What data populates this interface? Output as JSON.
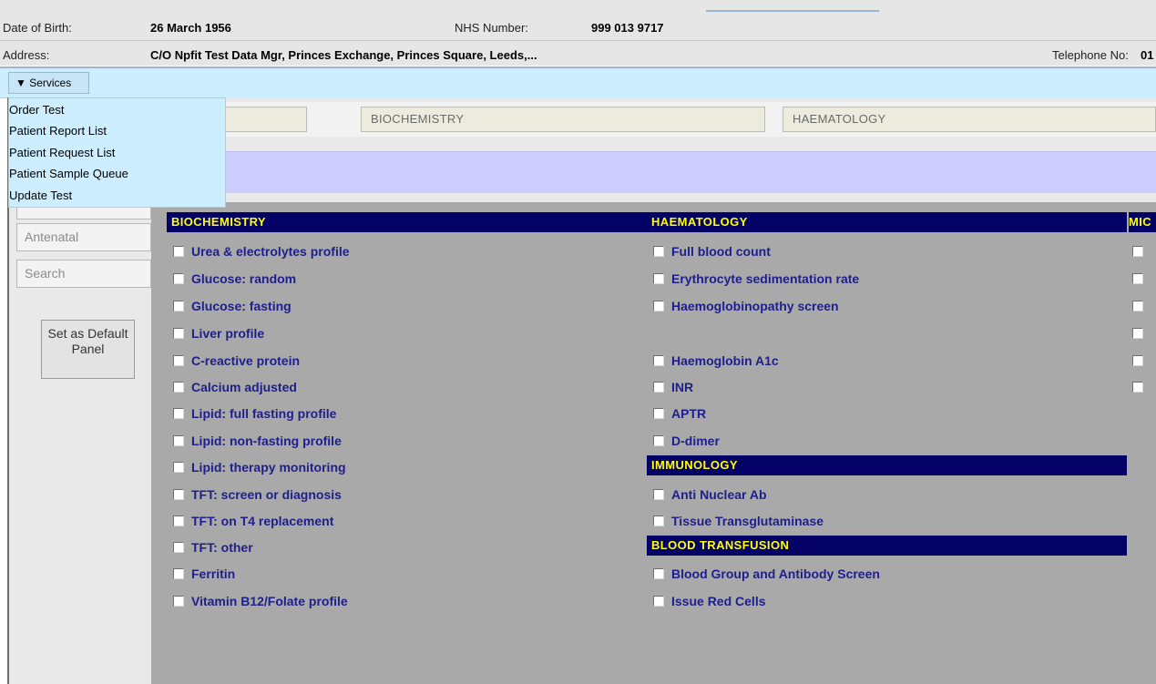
{
  "patient": {
    "dob_label": "Date of Birth:",
    "dob_value": "26 March 1956",
    "nhs_label": "NHS Number:",
    "nhs_value": "999 013 9717",
    "address_label": "Address:",
    "address_value": "C/O Npfit Test Data Mgr, Princes Exchange, Princes Square, Leeds,...",
    "telephone_label": "Telephone No:",
    "telephone_value": "01"
  },
  "services": {
    "button_label": "▼ Services",
    "menu": [
      "Order Test",
      "Patient Report List",
      "Patient Request List",
      "Patient Sample Queue",
      "Update Test"
    ]
  },
  "tabs": [
    "BIOCHEMISTRY",
    "HAEMATOLOGY"
  ],
  "sidebar": {
    "buttons": [
      "Antenatal",
      "Search"
    ],
    "set_default": "Set as Default Panel"
  },
  "panels": {
    "biochemistry": {
      "title": "BIOCHEMISTRY",
      "items": [
        "Urea & electrolytes profile",
        "Glucose: random",
        "Glucose: fasting",
        "Liver profile",
        "C-reactive protein",
        "Calcium adjusted",
        "Lipid: full fasting profile",
        "Lipid: non-fasting profile",
        "Lipid: therapy monitoring",
        "TFT: screen or diagnosis",
        "TFT: on T4 replacement",
        "TFT: other",
        "Ferritin",
        "Vitamin B12/Folate profile"
      ]
    },
    "haematology": {
      "title": "HAEMATOLOGY",
      "items": [
        "Full blood count",
        "Erythrocyte sedimentation rate",
        "Haemoglobinopathy screen",
        "Haemoglobin A1c",
        "INR",
        "APTR",
        "D-dimer"
      ]
    },
    "immunology": {
      "title": "IMMUNOLOGY",
      "items": [
        "Anti Nuclear Ab",
        "Tissue Transglutaminase"
      ]
    },
    "blood_transfusion": {
      "title": "BLOOD TRANSFUSION",
      "items": [
        "Blood Group and Antibody Screen",
        "Issue Red Cells"
      ]
    },
    "microbiology": {
      "title": "MIC"
    }
  },
  "colors": {
    "header_bg": "#030066",
    "header_text": "#ffff00",
    "item_text": "#1e1e8c",
    "grid_bg": "#a9a9a9",
    "services_bg": "#cceeff",
    "purple_bar": "#ccccff"
  }
}
